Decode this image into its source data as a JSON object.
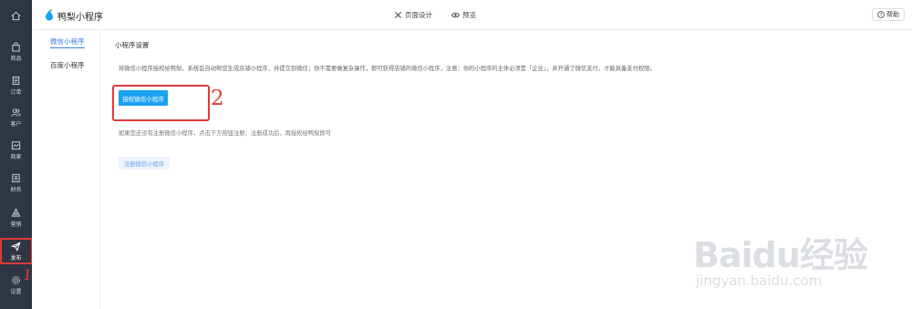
{
  "app": {
    "title": "鸭梨小程序"
  },
  "header": {
    "page_design": "页面设计",
    "preview": "预览",
    "help": "帮助"
  },
  "nav": {
    "items": [
      {
        "label": "",
        "icon": "home-icon"
      },
      {
        "label": "商品",
        "icon": "bag-icon"
      },
      {
        "label": "订单",
        "icon": "order-icon"
      },
      {
        "label": "客户",
        "icon": "users-icon"
      },
      {
        "label": "商家",
        "icon": "store-icon"
      },
      {
        "label": "财务",
        "icon": "finance-icon"
      },
      {
        "label": "营销",
        "icon": "marketing-icon"
      },
      {
        "label": "发布",
        "icon": "send-icon"
      },
      {
        "label": "设置",
        "icon": "gear-icon"
      }
    ]
  },
  "subnav": {
    "items": [
      {
        "label": "微信小程序"
      },
      {
        "label": "百度小程序"
      }
    ]
  },
  "main": {
    "section_title": "小程序设置",
    "intro": "将微信小程序授权给鸭梨，系统会自动帮您生成店铺小程序，并提交到微信；你不需要做复杂操作，即可获得店铺的微信小程序，注意：你的小程序的主体必须是「企业」，并开通了微信支付，才能具备支付权限。",
    "authorize_button": "授权微信小程序",
    "hint": "如果您还没有注册微信小程序，点击下方按钮注册；注册成功后，再授权给鸭梨即可",
    "register_button": "注册微信小程序"
  },
  "annotations": {
    "step1": "1",
    "step2": "2"
  },
  "watermark": {
    "brand": "Baidu经验",
    "url": "jingyan.baidu.com"
  },
  "colors": {
    "sidebar": "#2f3542",
    "primary": "#1aa2f2",
    "highlight": "#e03a3a",
    "link": "#3a7de0"
  }
}
